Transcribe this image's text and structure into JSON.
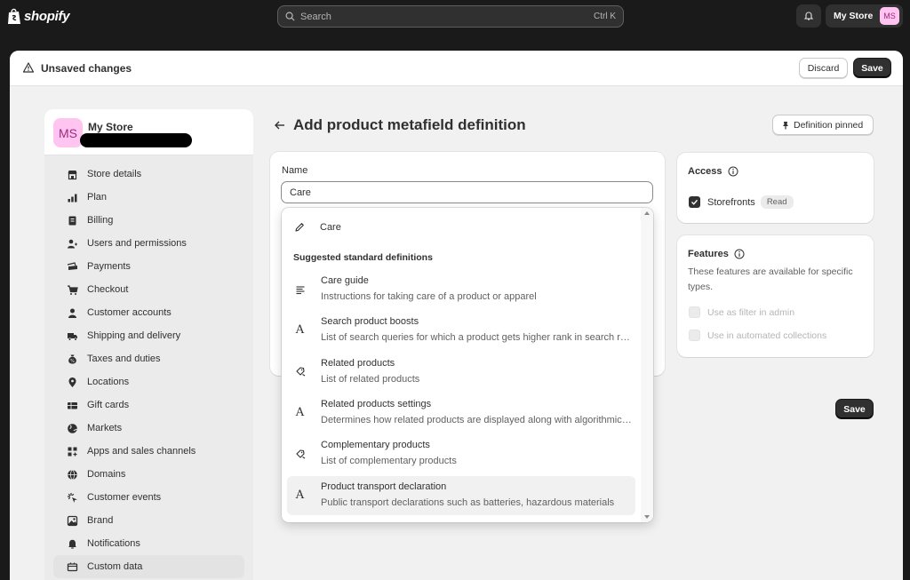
{
  "topbar": {
    "logo_text": "shopify",
    "search_placeholder": "Search",
    "search_shortcut": "Ctrl K",
    "store_name": "My Store",
    "store_initials": "MS"
  },
  "unsaved_bar": {
    "title": "Unsaved changes",
    "discard_label": "Discard",
    "save_label": "Save"
  },
  "sidebar": {
    "store_initials": "MS",
    "store_name": "My Store",
    "items": [
      {
        "label": "Store details",
        "icon": "store-icon"
      },
      {
        "label": "Plan",
        "icon": "plan-icon"
      },
      {
        "label": "Billing",
        "icon": "billing-icon"
      },
      {
        "label": "Users and permissions",
        "icon": "users-icon"
      },
      {
        "label": "Payments",
        "icon": "payments-icon"
      },
      {
        "label": "Checkout",
        "icon": "cart-icon"
      },
      {
        "label": "Customer accounts",
        "icon": "person-icon"
      },
      {
        "label": "Shipping and delivery",
        "icon": "truck-icon"
      },
      {
        "label": "Taxes and duties",
        "icon": "taxes-icon"
      },
      {
        "label": "Locations",
        "icon": "location-icon"
      },
      {
        "label": "Gift cards",
        "icon": "gift-card-icon"
      },
      {
        "label": "Markets",
        "icon": "globe-icon"
      },
      {
        "label": "Apps and sales channels",
        "icon": "apps-icon"
      },
      {
        "label": "Domains",
        "icon": "domain-globe-icon"
      },
      {
        "label": "Customer events",
        "icon": "sparkle-icon"
      },
      {
        "label": "Brand",
        "icon": "brand-icon"
      },
      {
        "label": "Notifications",
        "icon": "bell-icon"
      },
      {
        "label": "Custom data",
        "icon": "custom-data-icon"
      }
    ],
    "active_index": 17
  },
  "page": {
    "title": "Add product metafield definition",
    "pin_label": "Definition pinned"
  },
  "name_field": {
    "label": "Name",
    "value": "Care"
  },
  "dropdown": {
    "create_label": "Care",
    "section_title": "Suggested standard definitions",
    "items": [
      {
        "title": "Care guide",
        "description": "Instructions for taking care of a product or apparel",
        "icon": "paragraph-icon"
      },
      {
        "title": "Search product boosts",
        "description": "List of search queries for which a product gets higher rank in search results",
        "icon": "text-a-icon"
      },
      {
        "title": "Related products",
        "description": "List of related products",
        "icon": "product-reference-icon"
      },
      {
        "title": "Related products settings",
        "description": "Determines how related products are displayed along with algorithmic product recommendations",
        "icon": "text-a-icon"
      },
      {
        "title": "Complementary products",
        "description": "List of complementary products",
        "icon": "product-reference-icon"
      },
      {
        "title": "Product transport declaration",
        "description": "Public transport declarations such as batteries, hazardous materials",
        "icon": "text-a-icon"
      }
    ]
  },
  "access": {
    "title": "Access",
    "storefronts_label": "Storefronts",
    "storefronts_badge": "Read",
    "storefronts_checked": true
  },
  "features": {
    "title": "Features",
    "description": "These features are available for specific types.",
    "options": [
      {
        "label": "Use as filter in admin",
        "enabled": false
      },
      {
        "label": "Use in automated collections",
        "enabled": false
      }
    ]
  },
  "bottom_save_label": "Save",
  "colors": {
    "topbar_bg": "#1a1a1a",
    "primary_button": "#303030",
    "avatar_bg": "#ffc4f0",
    "page_bg": "#f1f1f1"
  }
}
